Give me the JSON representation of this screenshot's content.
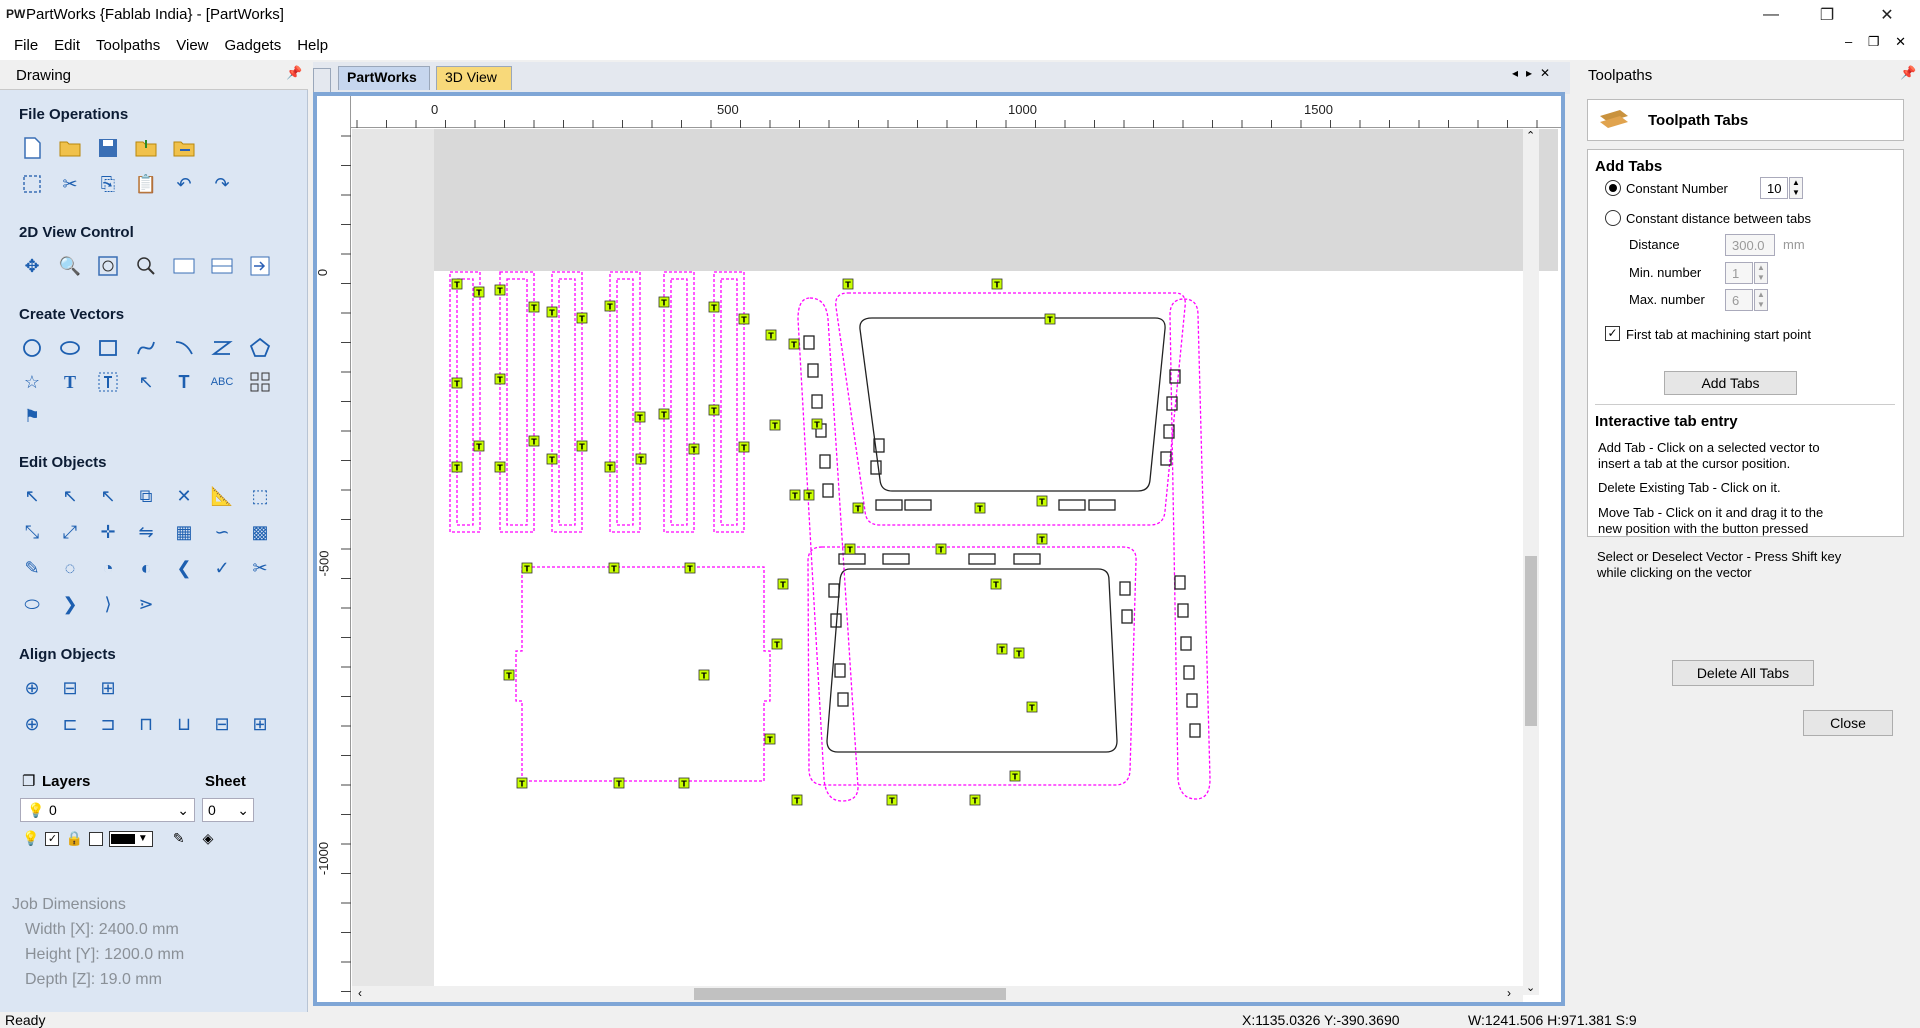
{
  "window": {
    "app_icon_text": "PW",
    "title": "PartWorks {Fablab India} - [PartWorks]",
    "minimize_glyph": "—",
    "maximize_glyph": "❐",
    "close_glyph": "✕"
  },
  "menubar": {
    "items": [
      "File",
      "Edit",
      "Toolpaths",
      "View",
      "Gadgets",
      "Help"
    ],
    "mdi_controls": "– ❐ ✕"
  },
  "left_panel": {
    "header": "Drawing",
    "sections": {
      "file_operations": "File Operations",
      "view_control": "2D View Control",
      "create_vectors": "Create Vectors",
      "edit_objects": "Edit Objects",
      "align_objects": "Align Objects"
    },
    "layers": {
      "label": "Layers",
      "sheet_label": "Sheet",
      "layer_value": "0",
      "sheet_value": "0"
    },
    "job_dimensions": {
      "title": "Job Dimensions",
      "width": "Width  [X]: 2400.0 mm",
      "height": "Height [Y]: 1200.0 mm",
      "depth": "Depth  [Z]: 19.0 mm"
    }
  },
  "tabs": {
    "active": "PartWorks",
    "other": "3D View"
  },
  "rulers": {
    "h_ticks": [
      "0",
      "500",
      "1000",
      "1500"
    ],
    "v_ticks": [
      "0",
      "-500",
      "-1000"
    ]
  },
  "right_panel": {
    "header": "Toolpaths",
    "card_title": "Toolpath Tabs",
    "add_tabs": {
      "title": "Add Tabs",
      "constant_number_label": "Constant Number",
      "constant_number_value": "10",
      "constant_distance_label": "Constant distance between tabs",
      "distance_label": "Distance",
      "distance_value": "300.0",
      "distance_unit": "mm",
      "min_label": "Min. number",
      "min_value": "1",
      "max_label": "Max. number",
      "max_value": "6",
      "first_tab_label": "First tab at machining start point",
      "add_tabs_button": "Add Tabs"
    },
    "interactive": {
      "title": "Interactive tab entry",
      "add_line1": "Add Tab - Click on a selected vector to",
      "add_line2": "insert a tab at the cursor position.",
      "delete_line": "Delete Existing Tab - Click on it.",
      "move_line1": "Move Tab - Click on it and drag it to the",
      "move_line2": "new position with the button pressed",
      "select_line1": "Select or Deselect Vector - Press Shift key",
      "select_line2": "while clicking on the vector",
      "delete_all_button": "Delete All Tabs"
    },
    "close_button": "Close"
  },
  "status": {
    "ready": "Ready",
    "coords": "X:1135.0326 Y:-390.3690",
    "size": "W:1241.506  H:971.381  S:9"
  },
  "colors": {
    "toolpath": "#ff00ff",
    "tab_marker": "#c8ff00",
    "panel_bg": "#dce6f3",
    "frame": "#7fa6d6"
  }
}
